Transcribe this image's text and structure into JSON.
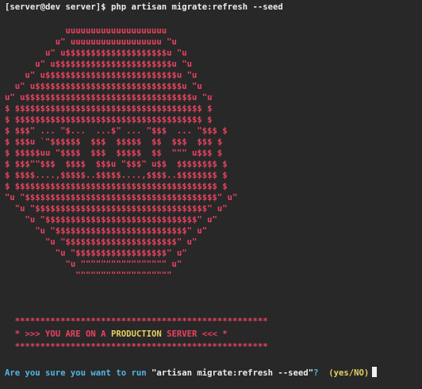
{
  "prompt": {
    "user_host_dir": "[server@dev server]$",
    "command": "php artisan migrate:refresh --seed"
  },
  "ascii_art": [
    "            uuuuuuuuuuuuuuuuuuuu",
    "          u\" uuuuuuuuuuuuuuuuuu \"u",
    "        u\" u$$$$$$$$$$$$$$$$$$$$u \"u",
    "      u\" u$$$$$$$$$$$$$$$$$$$$$$$u \"u",
    "    u\" u$$$$$$$$$$$$$$$$$$$$$$$$$$u \"u",
    "  u\" u$$$$$$$$$$$$$$$$$$$$$$$$$$$$$u \"u",
    "u\" u$$$$$$$$$$$$$$$$$$$$$$$$$$$$$$$$$u \"u",
    "$ $$$$$$$$$$$$$$$$$$$$$$$$$$$$$$$$$$$$$ $",
    "$ $$$$$$$$$$$$$$$$$$$$$$$$$$$$$$$$$$$$$ $",
    "$ $$$\" ... \"$...  ...$\" ... \"$$$  ... \"$$$ $",
    "$ $$$u `\"$$$$$$  $$$  $$$$$  $$  $$$  $$$ $",
    "$ $$$$$uu \"$$$$  $$$  $$$$$  $$  \"\"\" u$$$ $",
    "$ $$$\"\"$$$  $$$$  $$$u \"$$$\" u$$  $$$$$$$$ $",
    "$ $$$$....,$$$$$..$$$$$....,$$$$..$$$$$$$$ $",
    "$ $$$$$$$$$$$$$$$$$$$$$$$$$$$$$$$$$$$$$$$$ $",
    "\"u \"$$$$$$$$$$$$$$$$$$$$$$$$$$$$$$$$$$$$$$\" u\"",
    "  \"u \"$$$$$$$$$$$$$$$$$$$$$$$$$$$$$$$$$$\" u\"",
    "    \"u \"$$$$$$$$$$$$$$$$$$$$$$$$$$$$$$\" u\"",
    "      \"u \"$$$$$$$$$$$$$$$$$$$$$$$$$$\" u\"",
    "        \"u \"$$$$$$$$$$$$$$$$$$$$$$\" u\"",
    "          \"u \"$$$$$$$$$$$$$$$$$$\" u\"",
    "            \"u \"\"\"\"\"\"\"\"\"\"\"\"\"\"\"\"\" u\"",
    "              \"\"\"\"\"\"\"\"\"\"\"\"\"\"\"\"\"\"\""
  ],
  "banner": {
    "border_top": "  **************************************************",
    "line_prefix": "  * >>> YOU ARE ON A ",
    "highlight": "PRODUCTION",
    "line_suffix": " SERVER <<< *",
    "border_bottom": "  **************************************************"
  },
  "question": {
    "prefix": "Are you sure you want to run ",
    "command": "\"artisan migrate:refresh --seed\"",
    "suffix": "?  ",
    "choices": "(yes/NO)"
  }
}
